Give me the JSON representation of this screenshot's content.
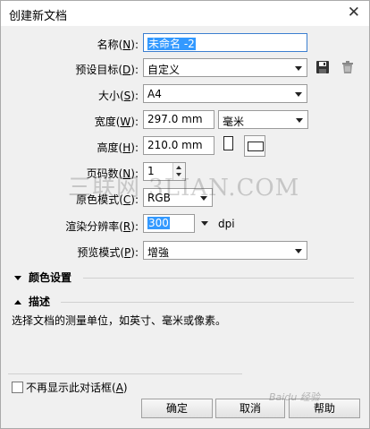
{
  "window": {
    "title": "创建新文档",
    "close_glyph": "✕"
  },
  "fields": {
    "name": {
      "label": "名称",
      "key": "N",
      "value": "未命名 -2"
    },
    "preset": {
      "label": "预设目标",
      "key": "D",
      "value": "自定义"
    },
    "size": {
      "label": "大小",
      "key": "S",
      "value": "A4"
    },
    "width": {
      "label": "宽度",
      "key": "W",
      "value": "297.0 mm",
      "unit": "毫米"
    },
    "height": {
      "label": "高度",
      "key": "H",
      "value": "210.0 mm"
    },
    "pages": {
      "label": "页码数",
      "key": "N",
      "value": "1"
    },
    "color_mode": {
      "label": "原色模式",
      "key": "C",
      "value": "RGB"
    },
    "resolution": {
      "label": "渲染分辨率",
      "key": "R",
      "value": "300",
      "unit": "dpi"
    },
    "preview": {
      "label": "预览模式",
      "key": "P",
      "value": "增強"
    }
  },
  "icons": [
    "save-preset-icon",
    "delete-preset-icon",
    "portrait-orientation-icon",
    "landscape-orientation-icon"
  ],
  "sections": {
    "color_settings": {
      "label": "颜色设置",
      "state": "collapsed"
    },
    "description": {
      "label": "描述",
      "state": "expanded",
      "text": "选择文档的测量单位，如英寸、毫米或像素。"
    }
  },
  "footer": {
    "checkbox_label": "不再显示此对话框",
    "checkbox_key": "A",
    "checked": false,
    "ok": "确定",
    "cancel": "取消",
    "help": "帮助"
  },
  "watermarks": {
    "site": "三联网 3LIAN.COM",
    "baidu": "Baidu 经验"
  },
  "colors": {
    "selection": "#3399ff",
    "background": "#f0f0f0",
    "focus_border": "#3c7fd0"
  }
}
